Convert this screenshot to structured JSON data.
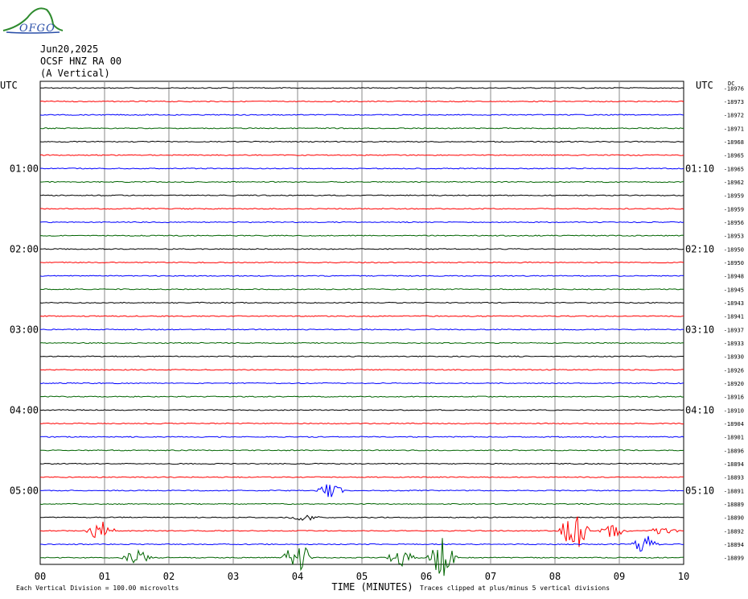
{
  "header": {
    "logo_text": "OFGO",
    "date": "Jun20,2025",
    "station": "OCSF HNZ RA 00",
    "component": "(A Vertical)"
  },
  "chart_data": {
    "type": "line",
    "title": "",
    "xlabel": "TIME (MINUTES)",
    "xlim": [
      0,
      10
    ],
    "x_ticks": [
      "00",
      "01",
      "02",
      "03",
      "04",
      "05",
      "06",
      "07",
      "08",
      "09",
      "10"
    ],
    "left_axis_label": "UTC",
    "right_axis_label": "UTC",
    "left_time_labels": [
      "01:00",
      "02:00",
      "03:00",
      "04:00",
      "05:00"
    ],
    "right_time_labels": [
      "01:10",
      "02:10",
      "03:10",
      "04:10",
      "05:10"
    ],
    "right_unit_label": "DC",
    "trace_colors": [
      "#000000",
      "#ff0000",
      "#0000ff",
      "#006400"
    ],
    "trace_offsets": [
      -18976,
      -18973,
      -18972,
      -18971,
      -18968,
      -18965,
      -18965,
      -18962,
      -18959,
      -18959,
      -18956,
      -18953,
      -18950,
      -18950,
      -18948,
      -18945,
      -18943,
      -18941,
      -18937,
      -18933,
      -18930,
      -18926,
      -18920,
      -18916,
      -18910,
      -18904,
      -18901,
      -18896,
      -18894,
      -18893,
      -18891,
      -18889,
      -18890,
      -18892,
      -18894,
      -18899
    ],
    "events": [
      {
        "trace": 30,
        "minute": 4.5,
        "amplitude": 0.6
      },
      {
        "trace": 32,
        "minute": 4.1,
        "amplitude": 0.3
      },
      {
        "trace": 33,
        "minute": 0.95,
        "amplitude": 0.8
      },
      {
        "trace": 33,
        "minute": 8.3,
        "amplitude": 1.8
      },
      {
        "trace": 33,
        "minute": 8.9,
        "amplitude": 0.6
      },
      {
        "trace": 33,
        "minute": 9.7,
        "amplitude": 0.4
      },
      {
        "trace": 34,
        "minute": 9.4,
        "amplitude": 0.8
      },
      {
        "trace": 35,
        "minute": 1.5,
        "amplitude": 0.6
      },
      {
        "trace": 35,
        "minute": 4.0,
        "amplitude": 1.5
      },
      {
        "trace": 35,
        "minute": 5.6,
        "amplitude": 0.7
      },
      {
        "trace": 35,
        "minute": 6.25,
        "amplitude": 1.5
      }
    ],
    "footer_left": "Each Vertical Division =  100.00 microvolts",
    "footer_right": "Traces clipped at plus/minus 5 vertical divisions"
  }
}
